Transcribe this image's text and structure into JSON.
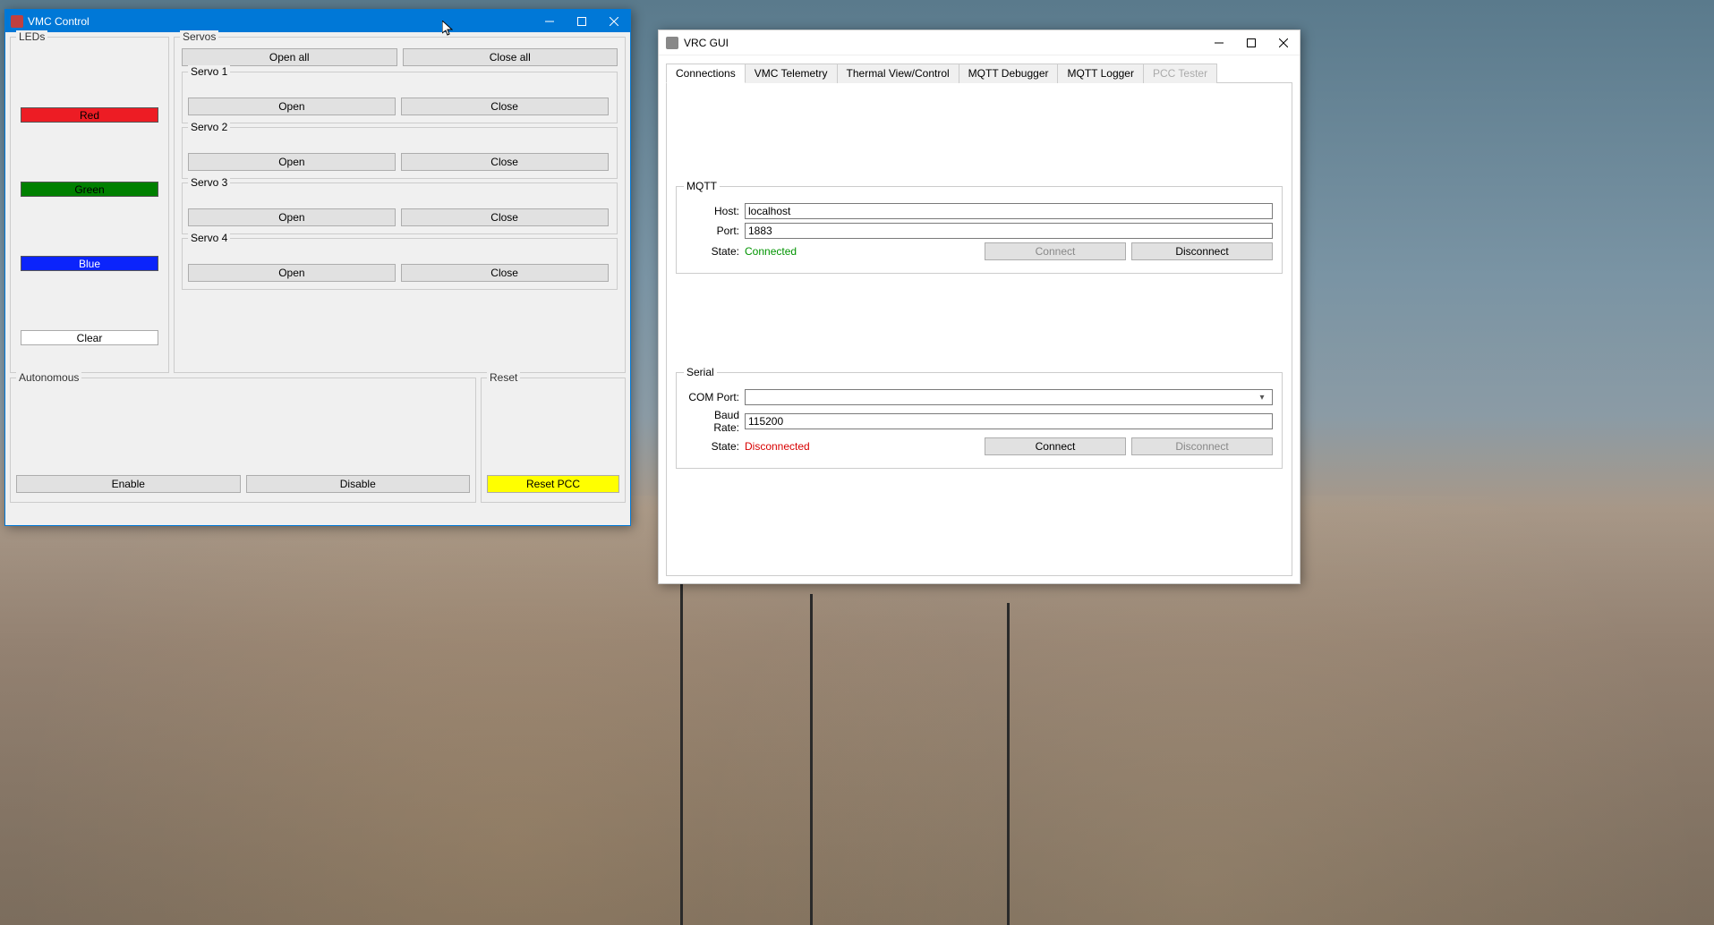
{
  "vmc": {
    "title": "VMC Control",
    "leds": {
      "title": "LEDs",
      "red": "Red",
      "green": "Green",
      "blue": "Blue",
      "clear": "Clear"
    },
    "servos": {
      "title": "Servos",
      "open_all": "Open all",
      "close_all": "Close all",
      "items": [
        {
          "title": "Servo 1",
          "open": "Open",
          "close": "Close"
        },
        {
          "title": "Servo 2",
          "open": "Open",
          "close": "Close"
        },
        {
          "title": "Servo 3",
          "open": "Open",
          "close": "Close"
        },
        {
          "title": "Servo 4",
          "open": "Open",
          "close": "Close"
        }
      ]
    },
    "autonomous": {
      "title": "Autonomous",
      "enable": "Enable",
      "disable": "Disable"
    },
    "reset": {
      "title": "Reset",
      "reset_pcc": "Reset PCC"
    }
  },
  "vrc": {
    "title": "VRC GUI",
    "tabs": [
      {
        "label": "Connections",
        "active": true
      },
      {
        "label": "VMC Telemetry"
      },
      {
        "label": "Thermal View/Control"
      },
      {
        "label": "MQTT Debugger"
      },
      {
        "label": "MQTT Logger"
      },
      {
        "label": "PCC Tester",
        "disabled": true
      }
    ],
    "mqtt": {
      "legend": "MQTT",
      "host_label": "Host:",
      "host_value": "localhost",
      "port_label": "Port:",
      "port_value": "1883",
      "state_label": "State:",
      "state_value": "Connected",
      "connect": "Connect",
      "disconnect": "Disconnect"
    },
    "serial": {
      "legend": "Serial",
      "com_label": "COM Port:",
      "com_value": "",
      "baud_label": "Baud Rate:",
      "baud_value": "115200",
      "state_label": "State:",
      "state_value": "Disconnected",
      "connect": "Connect",
      "disconnect": "Disconnect"
    }
  }
}
